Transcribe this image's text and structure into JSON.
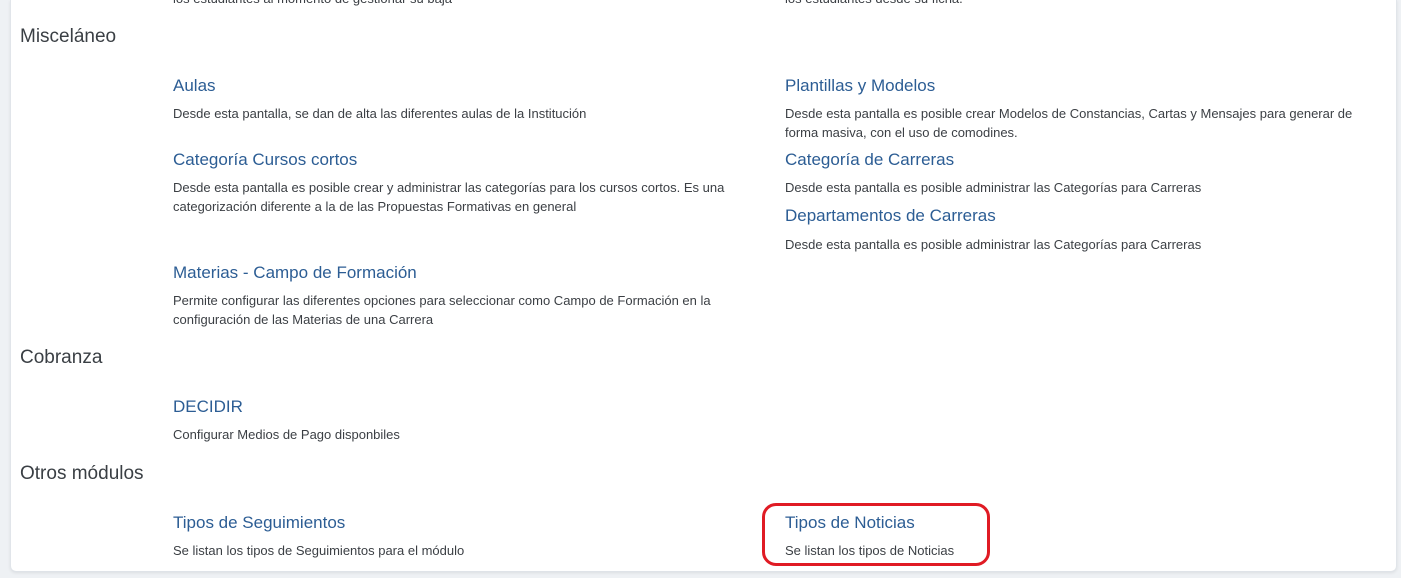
{
  "clipped_top": {
    "left_text": "los estudiantes al momento de gestionar su baja",
    "right_text": "los estudiantes desde su ficha."
  },
  "sections": {
    "miscelaneo": {
      "title": "Misceláneo",
      "aulas": {
        "title": "Aulas",
        "desc": "Desde esta pantalla, se dan de alta las diferentes aulas de la Institución"
      },
      "plantillas": {
        "title": "Plantillas y Modelos",
        "desc": "Desde esta pantalla es posible crear Modelos de Constancias, Cartas y Mensajes para generar de forma masiva, con el uso de comodines."
      },
      "categoria_cursos": {
        "title": "Categoría Cursos cortos",
        "desc": "Desde esta pantalla es posible crear y administrar las categorías para los cursos cortos. Es una categorización diferente a la de las Propuestas Formativas en general"
      },
      "categoria_carreras": {
        "title": "Categoría de Carreras",
        "desc": "Desde esta pantalla es posible administrar las Categorías para Carreras"
      },
      "departamentos": {
        "title": "Departamentos de Carreras",
        "desc": "Desde esta pantalla es posible administrar las Categorías para Carreras"
      },
      "materias_campo": {
        "title": "Materias - Campo de Formación",
        "desc": "Permite configurar las diferentes opciones para seleccionar como Campo de Formación en la configuración de las Materias de una Carrera"
      }
    },
    "cobranza": {
      "title": "Cobranza",
      "decidir": {
        "title": "DECIDIR",
        "desc": "Configurar Medios de Pago disponbiles"
      }
    },
    "otros": {
      "title": "Otros módulos",
      "seguimientos": {
        "title": "Tipos de Seguimientos",
        "desc": "Se listan los tipos de Seguimientos para el módulo"
      },
      "noticias": {
        "title": "Tipos de Noticias",
        "desc": "Se listan los tipos de Noticias"
      }
    }
  },
  "colors": {
    "link": "#2c5d94",
    "text": "#3b3f44",
    "highlight": "#e01b24"
  }
}
